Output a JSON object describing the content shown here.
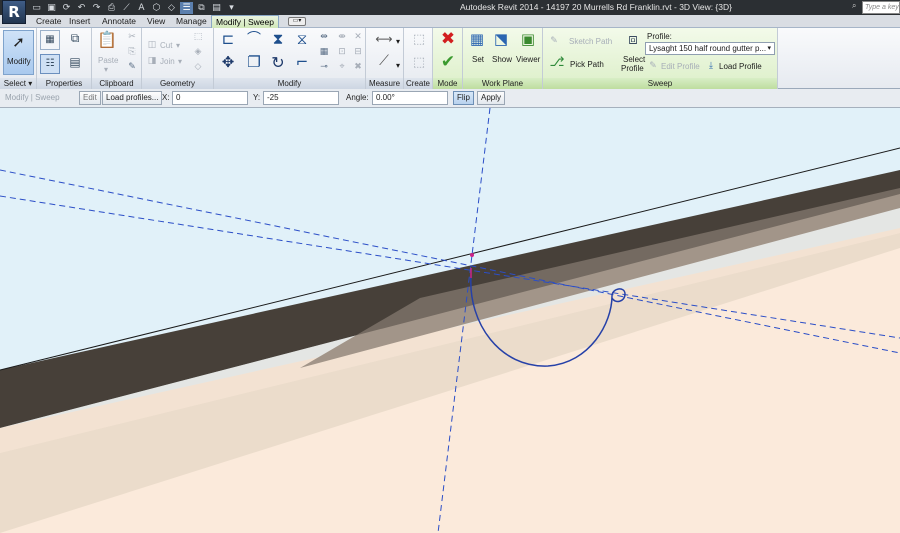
{
  "app": {
    "logo_letter": "R",
    "title": "Autodesk Revit 2014 -    14197 20 Murrells Rd Franklin.rvt - 3D View: {3D}",
    "search_placeholder": "Type a keyw"
  },
  "quick_access": [
    "open-icon",
    "save-icon",
    "sync-icon",
    "undo-icon",
    "redo-icon",
    "print-icon",
    "measure-icon",
    "tag-icon",
    "3d-view-icon",
    "switch-windows-icon",
    "thin-lines-icon",
    "close-hidden-icon",
    "dropdown-icon"
  ],
  "tabs": [
    {
      "label": "Create"
    },
    {
      "label": "Insert"
    },
    {
      "label": "Annotate"
    },
    {
      "label": "View"
    },
    {
      "label": "Manage"
    },
    {
      "label": "Modify | Sweep"
    }
  ],
  "ribbon": {
    "select": {
      "button": "Modify",
      "panel": "Select ▾"
    },
    "properties": {
      "panel": "Properties"
    },
    "clipboard": {
      "panel": "Clipboard",
      "paste": "Paste"
    },
    "geometry": {
      "panel": "Geometry",
      "cut": "Cut",
      "join": "Join"
    },
    "modify": {
      "panel": "Modify"
    },
    "measure": {
      "panel": "Measure"
    },
    "create": {
      "panel": "Create"
    },
    "mode": {
      "panel": "Mode"
    },
    "workplane": {
      "panel": "Work Plane",
      "set": "Set",
      "show": "Show",
      "viewer": "Viewer"
    },
    "sweep": {
      "panel": "Sweep",
      "sketch_path": "Sketch Path",
      "pick_path": "Pick Path",
      "select_profile_1": "Select",
      "select_profile_2": "Profile",
      "profile_label": "Profile:",
      "profile_value": "Lysaght 150 half round gutter p...",
      "edit_profile": "Edit Profile",
      "load_profile": "Load Profile"
    }
  },
  "options_bar": {
    "context": "Modify | Sweep",
    "edit": "Edit",
    "load_profiles": "Load profiles...",
    "x_label": "X:",
    "x_value": "0",
    "y_label": "Y:",
    "y_value": "-25",
    "angle_label": "Angle:",
    "angle_value": "0.00°",
    "flip": "Flip",
    "apply": "Apply"
  },
  "colors": {
    "sky": "#e1f1f9",
    "fascia_dark": "#474039",
    "fascia_mid": "#746a61",
    "soffit": "#ebdccb",
    "ground": "#fbeadb",
    "profile_blue": "#2641a8",
    "reference_line": "#2b4ec7"
  }
}
